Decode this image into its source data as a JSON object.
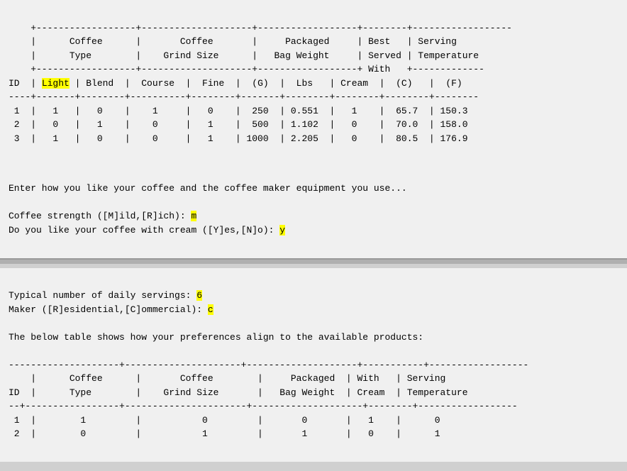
{
  "top_panel": {
    "table_header_line1": "    +------------------+--------------------+------------------+--------+------------------",
    "table_header_cols": "    |      Coffee      |      Coffee        |     Packaged     | Best   | Serving          ",
    "table_header_cols2": "    |      Type        |    Grind Size      |   Bag Weight     | Served | Temperature      ",
    "table_header_line2": "    +------------------+--------------------+------------------+ With   +------------------",
    "table_col_labels": "ID  | Light | Blend  |  Course  |  Fine  |  (G)  |  Lbs   | Cream  |   (C)  |   (F)    ",
    "table_divider": "----+-------+--------+----------+--------+-------+--------+--------+--------+----------",
    "rows": [
      {
        "id": "1",
        "light": "1",
        "blend": "0",
        "course": "1",
        "fine": "0",
        "g": "250",
        "lbs": "0.551",
        "cream": "1",
        "c": "65.7",
        "f": "150.3"
      },
      {
        "id": "2",
        "light": "0",
        "blend": "1",
        "course": "0",
        "fine": "1",
        "g": "500",
        "lbs": "1.102",
        "cream": "0",
        "c": "70.0",
        "f": "158.0"
      },
      {
        "id": "3",
        "light": "1",
        "blend": "0",
        "course": "0",
        "fine": "1",
        "g": "1000",
        "lbs": "2.205",
        "cream": "0",
        "c": "80.5",
        "f": "176.9"
      }
    ],
    "prompt_intro": "Enter how you like your coffee and the coffee maker equipment you use...",
    "prompt_strength": "Coffee strength ([M]ild,[R]ich): ",
    "strength_value": "m",
    "prompt_cream": "Do you like your coffee with cream ([Y]es,[N]o): ",
    "cream_value": "y"
  },
  "bottom_panel": {
    "prompt_servings": "Typical number of daily servings: ",
    "servings_value": "6",
    "prompt_maker": "Maker ([R]esidential,[C]ommercial): ",
    "maker_value": "c",
    "result_intro": "The below table shows how your preferences align to the available products:",
    "table_header_line1": "--------------------+--------------------+--------------------+----------+------------------",
    "table_col_line1": "    |      Coffee      |         Coffee     |     Packaged  | With   | Serving          ",
    "table_col_line2": "ID  |      Type        |      Grind Size    |   Bag Weight  | Cream  | Temperature      ",
    "table_divider": "--+-----------------+---------------------+---------------------+--------+------------------",
    "rows": [
      {
        "id": "1",
        "col1": "1",
        "col2": "0",
        "col3": "0",
        "col4": "1",
        "col5": "0"
      },
      {
        "id": "2",
        "col1": "0",
        "col2": "1",
        "col3": "1",
        "col4": "0",
        "col5": "1"
      }
    ]
  }
}
